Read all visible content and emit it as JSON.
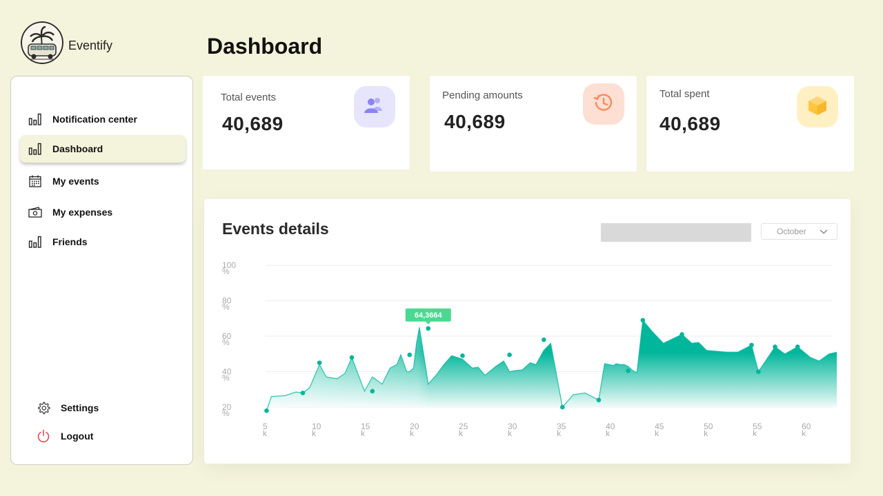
{
  "app": {
    "brand": "Eventify",
    "page_title": "Dashboard"
  },
  "sidebar": {
    "items": [
      {
        "label": "Notification center",
        "icon": "bar-chart-icon",
        "active": false
      },
      {
        "label": "Dashboard",
        "icon": "bar-chart-icon",
        "active": true
      },
      {
        "label": "My events",
        "icon": "calendar-icon",
        "active": false
      },
      {
        "label": "My expenses",
        "icon": "cash-icon",
        "active": false
      },
      {
        "label": "Friends",
        "icon": "bar-chart-icon",
        "active": false
      }
    ],
    "bottom": [
      {
        "label": "Settings",
        "icon": "gear-icon"
      },
      {
        "label": "Logout",
        "icon": "power-icon"
      }
    ]
  },
  "stats": [
    {
      "label": "Total events",
      "value": "40,689",
      "icon": "users-icon",
      "badge_color": "#e6e5fb",
      "icon_color": "#8b83f0"
    },
    {
      "label": "Pending amounts",
      "value": "40,689",
      "icon": "history-icon",
      "badge_color": "#fddfd3",
      "icon_color": "#fb8a5c"
    },
    {
      "label": "Total spent",
      "value": "40,689",
      "icon": "box-icon",
      "badge_color": "#fff0c4",
      "icon_color": "#fec53d"
    }
  ],
  "events": {
    "title": "Events details",
    "month": "October",
    "tooltip": "64,3664",
    "colors": {
      "line": "#00b69b",
      "tooltip": "#4ad991"
    }
  },
  "chart_data": {
    "type": "area",
    "title": "Events details",
    "xlabel": "",
    "ylabel": "",
    "x_ticks": [
      "5k",
      "10k",
      "15k",
      "20k",
      "25k",
      "30k",
      "35k",
      "40k",
      "45k",
      "50k",
      "55k",
      "60k"
    ],
    "y_ticks": [
      "20%",
      "40%",
      "60%",
      "80%",
      "100%"
    ],
    "xlim": [
      5,
      63.3
    ],
    "ylim": [
      20,
      100
    ],
    "grid": true,
    "x": [
      5.1,
      5.6,
      7.0,
      8.1,
      8.8,
      9.5,
      10.5,
      11.2,
      12.3,
      13.1,
      13.8,
      15.1,
      15.9,
      16.9,
      17.7,
      18.4,
      18.8,
      19.4,
      19.7,
      20.1,
      20.4,
      20.7,
      21.6,
      22.4,
      23.2,
      24.0,
      25.1,
      26.1,
      26.7,
      27.4,
      28.5,
      29.3,
      29.9,
      30.4,
      31.2,
      32.0,
      32.6,
      33.4,
      34.1,
      35.3,
      36.4,
      37.6,
      39.0,
      39.6,
      40.5,
      40.8,
      41.2,
      41.6,
      42.0,
      42.5,
      42.9,
      43.5,
      44.4,
      45.6,
      47.5,
      48.5,
      49.2,
      50.0,
      52.1,
      53.2,
      54.6,
      55.3,
      57.0,
      58.0,
      59.3,
      60.6,
      61.5,
      62.5,
      63.3
    ],
    "values": [
      18,
      26,
      26.5,
      28.5,
      28,
      31,
      44,
      37,
      36,
      39,
      48,
      29,
      37,
      33,
      42,
      44,
      49.5,
      40,
      40,
      42,
      56,
      65,
      33,
      38,
      44,
      49,
      47,
      42,
      42.5,
      38,
      43,
      46,
      40,
      40.5,
      41,
      45,
      44,
      52,
      56,
      20,
      27,
      28,
      24,
      44.5,
      43.5,
      44.5,
      44,
      44,
      43,
      40.5,
      39.5,
      69,
      63,
      56,
      61,
      56,
      56.5,
      52,
      51,
      51,
      55,
      40,
      54,
      50,
      54,
      48,
      46,
      50,
      51
    ],
    "markers": [
      [
        5.1,
        18
      ],
      [
        8.8,
        28
      ],
      [
        10.5,
        45
      ],
      [
        13.8,
        48
      ],
      [
        15.9,
        29
      ],
      [
        19.7,
        49.5
      ],
      [
        21.6,
        64.3664
      ],
      [
        25.1,
        49
      ],
      [
        29.9,
        49.5
      ],
      [
        33.4,
        58
      ],
      [
        35.3,
        20
      ],
      [
        39.0,
        24
      ],
      [
        42.0,
        40.5
      ],
      [
        43.5,
        69
      ],
      [
        44.4,
        56
      ],
      [
        47.5,
        61
      ],
      [
        54.6,
        55
      ],
      [
        55.3,
        40
      ],
      [
        57.0,
        54
      ],
      [
        59.3,
        54
      ]
    ],
    "peak_x": 21.6
  }
}
